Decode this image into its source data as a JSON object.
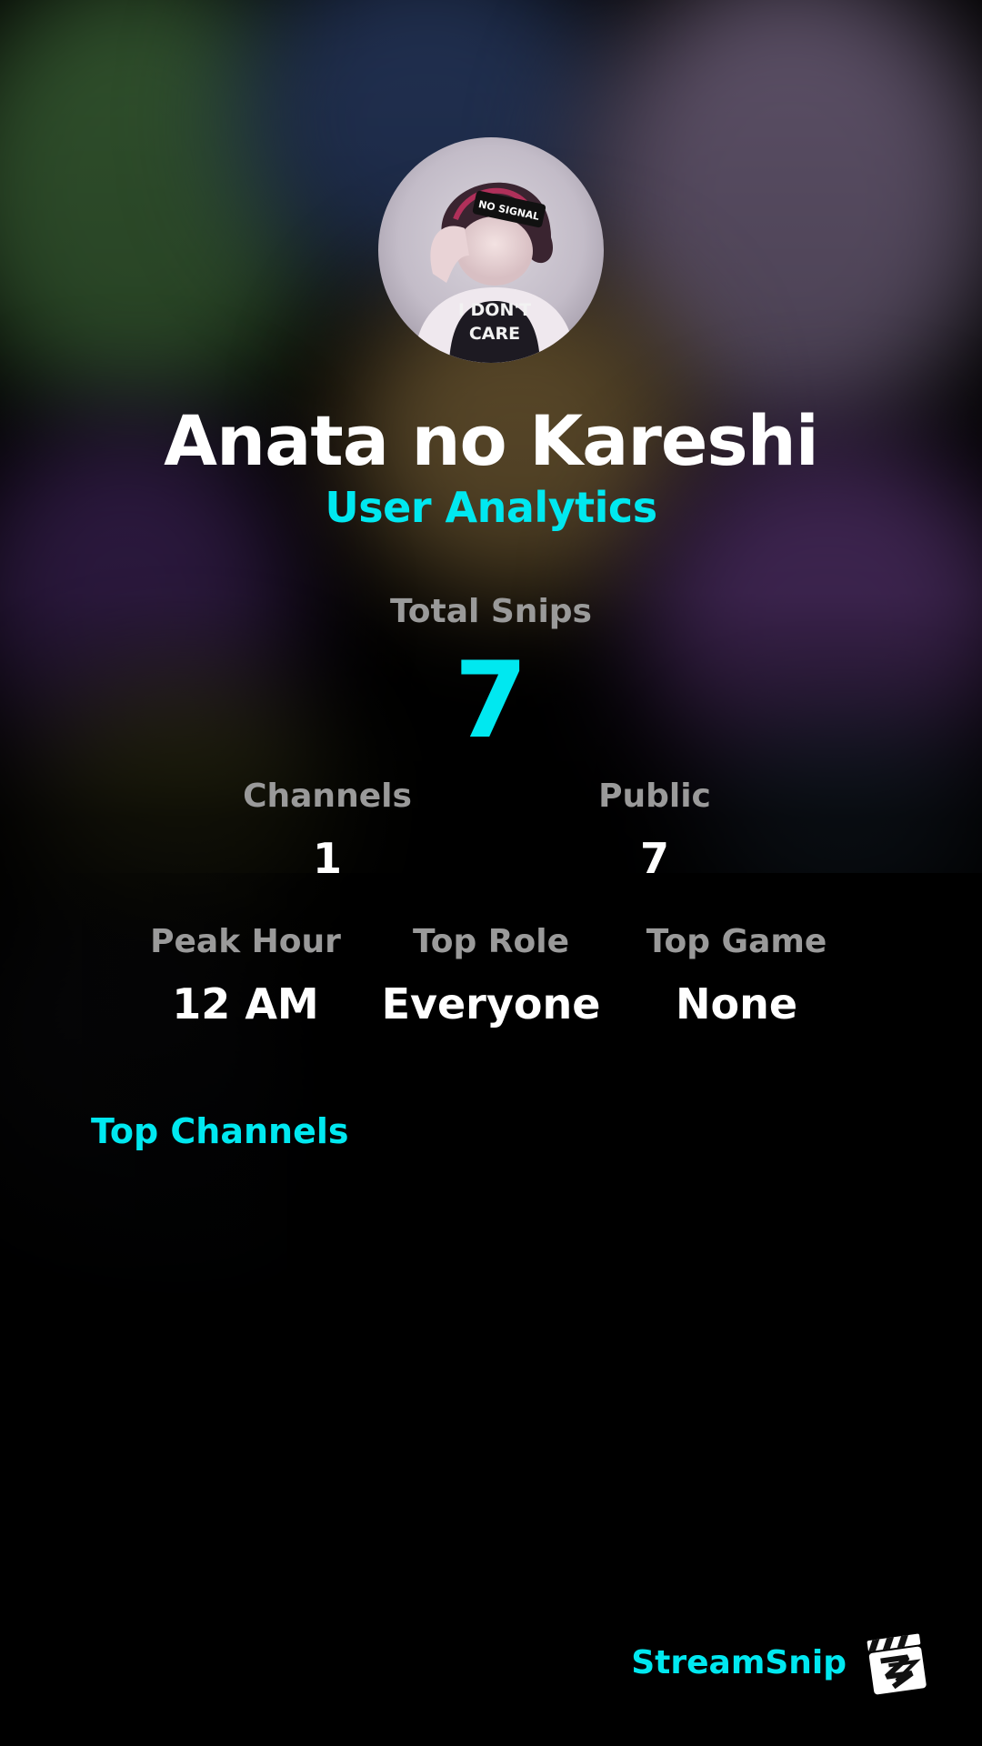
{
  "user": {
    "name": "Anata no Kareshi",
    "avatar_text_top": "NO SIGNAL",
    "avatar_shirt_line1": "I DON'T",
    "avatar_shirt_line2": "CARE"
  },
  "header": {
    "subtitle": "User Analytics"
  },
  "stats": {
    "total_snips": {
      "label": "Total Snips",
      "value": "7"
    },
    "channels": {
      "label": "Channels",
      "value": "1"
    },
    "public": {
      "label": "Public",
      "value": "7"
    },
    "peak_hour": {
      "label": "Peak Hour",
      "value": "12 AM"
    },
    "top_role": {
      "label": "Top Role",
      "value": "Everyone"
    },
    "top_game": {
      "label": "Top Game",
      "value": "None"
    }
  },
  "sections": {
    "top_channels": "Top Channels"
  },
  "brand": {
    "name": "StreamSnip",
    "logo_icon": "clapperboard-icon"
  },
  "colors": {
    "accent": "#00e8f0",
    "label": "#9a9a9a",
    "value": "#ffffff",
    "background": "#000000"
  }
}
